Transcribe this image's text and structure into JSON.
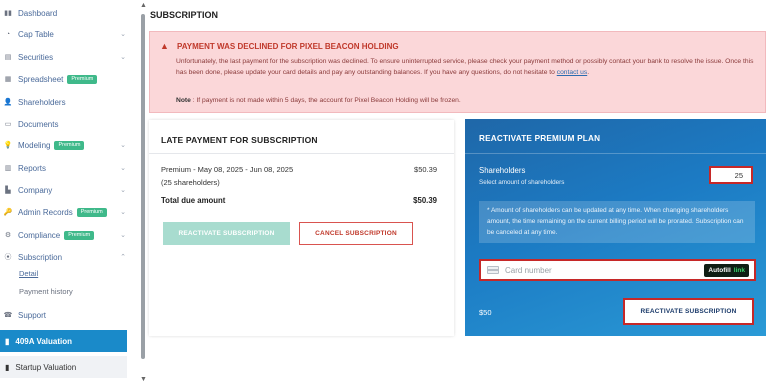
{
  "sidebar": {
    "items": [
      {
        "label": "Dashboard",
        "icon": "dashboard-icon",
        "has_chevron": false
      },
      {
        "label": "Cap Table",
        "icon": "cap-table-icon",
        "has_chevron": true
      },
      {
        "label": "Securities",
        "icon": "securities-icon",
        "has_chevron": true
      },
      {
        "label": "Spreadsheet",
        "icon": "spreadsheet-icon",
        "has_chevron": false,
        "badge": "Premium"
      },
      {
        "label": "Shareholders",
        "icon": "user-icon",
        "has_chevron": false
      },
      {
        "label": "Documents",
        "icon": "documents-icon",
        "has_chevron": false
      },
      {
        "label": "Modeling",
        "icon": "modeling-icon",
        "has_chevron": true,
        "badge": "Premium"
      },
      {
        "label": "Reports",
        "icon": "reports-icon",
        "has_chevron": true
      },
      {
        "label": "Company",
        "icon": "company-icon",
        "has_chevron": true
      },
      {
        "label": "Admin Records",
        "icon": "admin-records-icon",
        "has_chevron": true,
        "badge": "Premium"
      },
      {
        "label": "Compliance",
        "icon": "compliance-icon",
        "has_chevron": true,
        "badge": "Premium"
      },
      {
        "label": "Subscription",
        "icon": "subscription-icon",
        "has_chevron": true,
        "expanded": true
      }
    ],
    "subscription_children": [
      {
        "label": "Detail",
        "active": true
      },
      {
        "label": "Payment history",
        "active": false
      }
    ],
    "support": "Support",
    "valuation_409a": "409A Valuation",
    "startup_valuation": "Startup Valuation"
  },
  "page": {
    "title": "SUBSCRIPTION"
  },
  "alert": {
    "title": "PAYMENT WAS DECLINED FOR PIXEL BEACON HOLDING",
    "body": "Unfortunately, the last payment for the subscription was declined. To ensure uninterrupted service, please check your payment method or possibly contact your bank to resolve the issue. Once this has been done, please update your card details and pay any outstanding balances. If you have any questions, do not hesitate to ",
    "link": "contact us",
    "body_end": ".",
    "note_label": "Note",
    "note_text": " : If payment is not made within 5 days, the account for Pixel Beacon Holding will be frozen."
  },
  "late_payment": {
    "title": "LATE PAYMENT FOR SUBSCRIPTION",
    "line1": "Premium - May 08, 2025 - Jun 08, 2025",
    "line2": "(25 shareholders)",
    "amount": "$50.39",
    "total_label": "Total due amount",
    "total_value": "$50.39",
    "reactivate_label": "REACTIVATE SUBSCRIPTION",
    "cancel_label": "CANCEL SUBSCRIPTION"
  },
  "premium": {
    "title": "REACTIVATE PREMIUM PLAN",
    "shareholders_label": "Shareholders",
    "shareholders_sub": "Select amount of shareholders",
    "shareholders_value": "25",
    "info": "* Amount of shareholders can be updated at any time. When changing shareholders amount, the time remaining on the current billing period will be prorated. Subscription can be canceled at any time.",
    "card_placeholder": "Card number",
    "autofill": "Autofill",
    "autofill_link": "link",
    "price": "$50",
    "reactivate_label": "REACTIVATE SUBSCRIPTION"
  },
  "colors": {
    "accent_blue": "#1a8ac9",
    "alert_bg": "#fbd7d9",
    "alert_text": "#c0392b",
    "premium_green": "#3fb98a"
  }
}
